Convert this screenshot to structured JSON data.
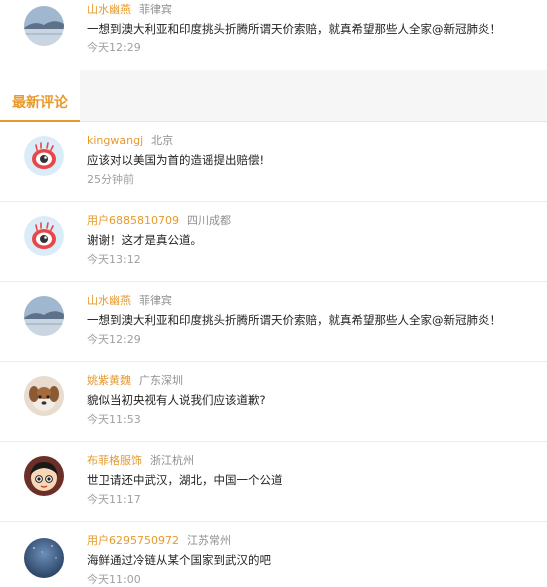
{
  "top_comment": {
    "username": "山水幽燕",
    "location": "菲律宾",
    "text": "一想到澳大利亚和印度挑头折腾所谓天价索赔，就真希望那些人全家@新冠肺炎！",
    "time": "今天12:29",
    "avatar": "lake-landscape"
  },
  "section": {
    "title": "最新评论"
  },
  "comments": [
    {
      "username": "kingwangj",
      "location": "北京",
      "text": "应该对以美国为首的造谣提出赔偿!",
      "time": "25分钟前",
      "avatar": "weibo-eye"
    },
    {
      "username": "用户6885810709",
      "location": "四川成都",
      "text": "谢谢！这才是真公道。",
      "time": "今天13:12",
      "avatar": "weibo-eye"
    },
    {
      "username": "山水幽燕",
      "location": "菲律宾",
      "text": "一想到澳大利亚和印度挑头折腾所谓天价索赔，就真希望那些人全家@新冠肺炎！",
      "time": "今天12:29",
      "avatar": "lake-landscape"
    },
    {
      "username": "姚紫黄魏",
      "location": "广东深圳",
      "text": "貌似当初央视有人说我们应该道歉?",
      "time": "今天11:53",
      "avatar": "puppy"
    },
    {
      "username": "布菲格服饰",
      "location": "浙江杭州",
      "text": "世卫请还中武汉，湖北，中国一个公道",
      "time": "今天11:17",
      "avatar": "cartoon-boy"
    },
    {
      "username": "用户6295750972",
      "location": "江苏常州",
      "text": "海鲜通过冷链从某个国家到武汉的吧",
      "time": "今天11:00",
      "avatar": "night-sky"
    }
  ]
}
